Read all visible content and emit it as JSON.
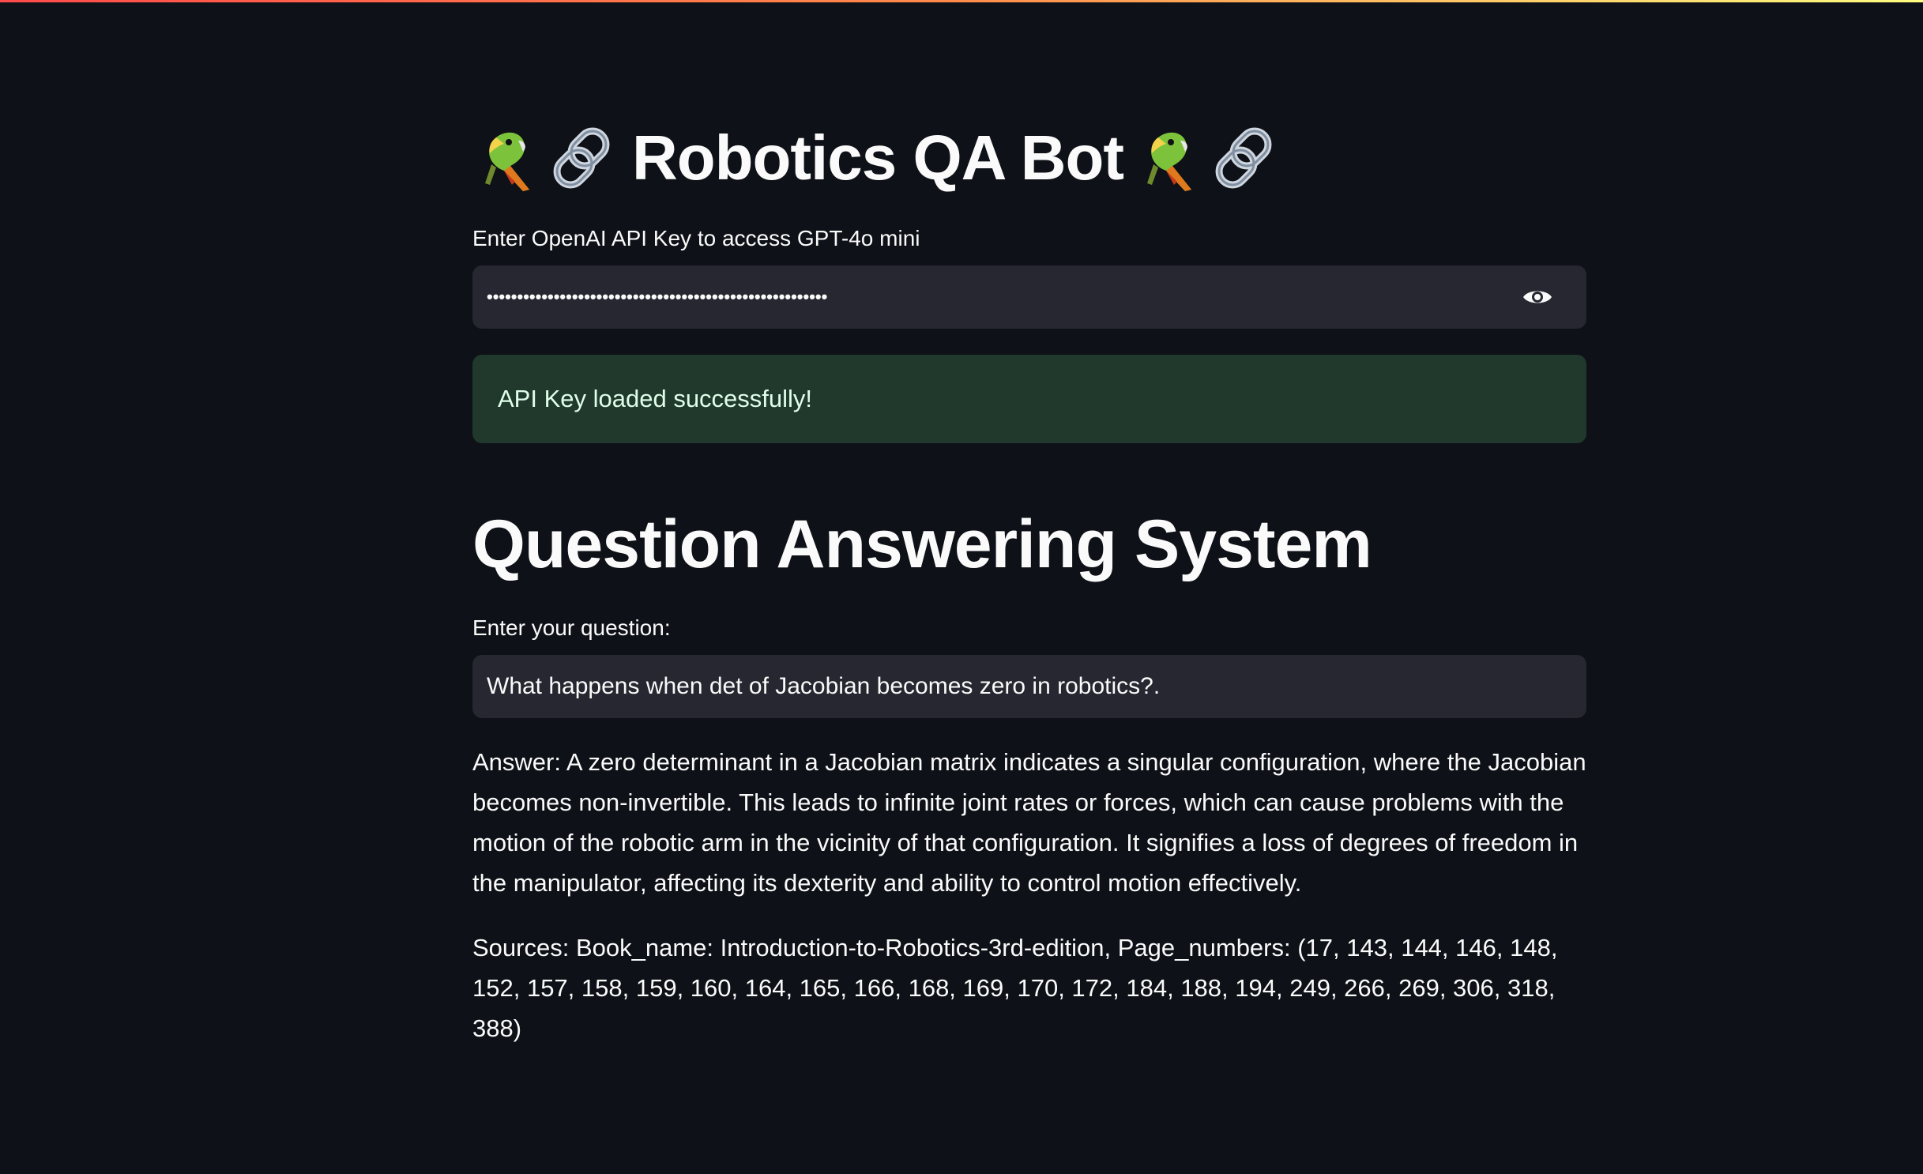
{
  "header": {
    "title": "Robotics QA Bot",
    "accent_gradient": [
      "#ff4b4b",
      "#fffd80"
    ]
  },
  "icons": {
    "left": [
      "parrot-icon",
      "link-icon"
    ],
    "right": [
      "parrot-icon",
      "link-icon"
    ]
  },
  "api_key": {
    "label": "Enter OpenAI API Key to access GPT-4o mini",
    "masked_value": "••••••••••••••••••••••••••••••••••••••••••••••••••••••••",
    "toggle_icon": "eye-icon"
  },
  "status": {
    "message": "API Key loaded successfully!",
    "color": "#21392c"
  },
  "qa": {
    "heading": "Question Answering System",
    "question_label": "Enter your question:",
    "question_value": "What happens when det of Jacobian becomes zero in robotics?.",
    "answer": "Answer: A zero determinant in a Jacobian matrix indicates a singular configuration, where the Jacobian becomes non-invertible. This leads to infinite joint rates or forces, which can cause problems with the motion of the robotic arm in the vicinity of that configuration. It signifies a loss of degrees of freedom in the manipulator, affecting its dexterity and ability to control motion effectively.",
    "sources": "Sources: Book_name: Introduction-to-Robotics-3rd-edition, Page_numbers: (17, 143, 144, 146, 148, 152, 157, 158, 159, 160, 164, 165, 166, 168, 169, 170, 172, 184, 188, 194, 249, 266, 269, 306, 318, 388)"
  }
}
